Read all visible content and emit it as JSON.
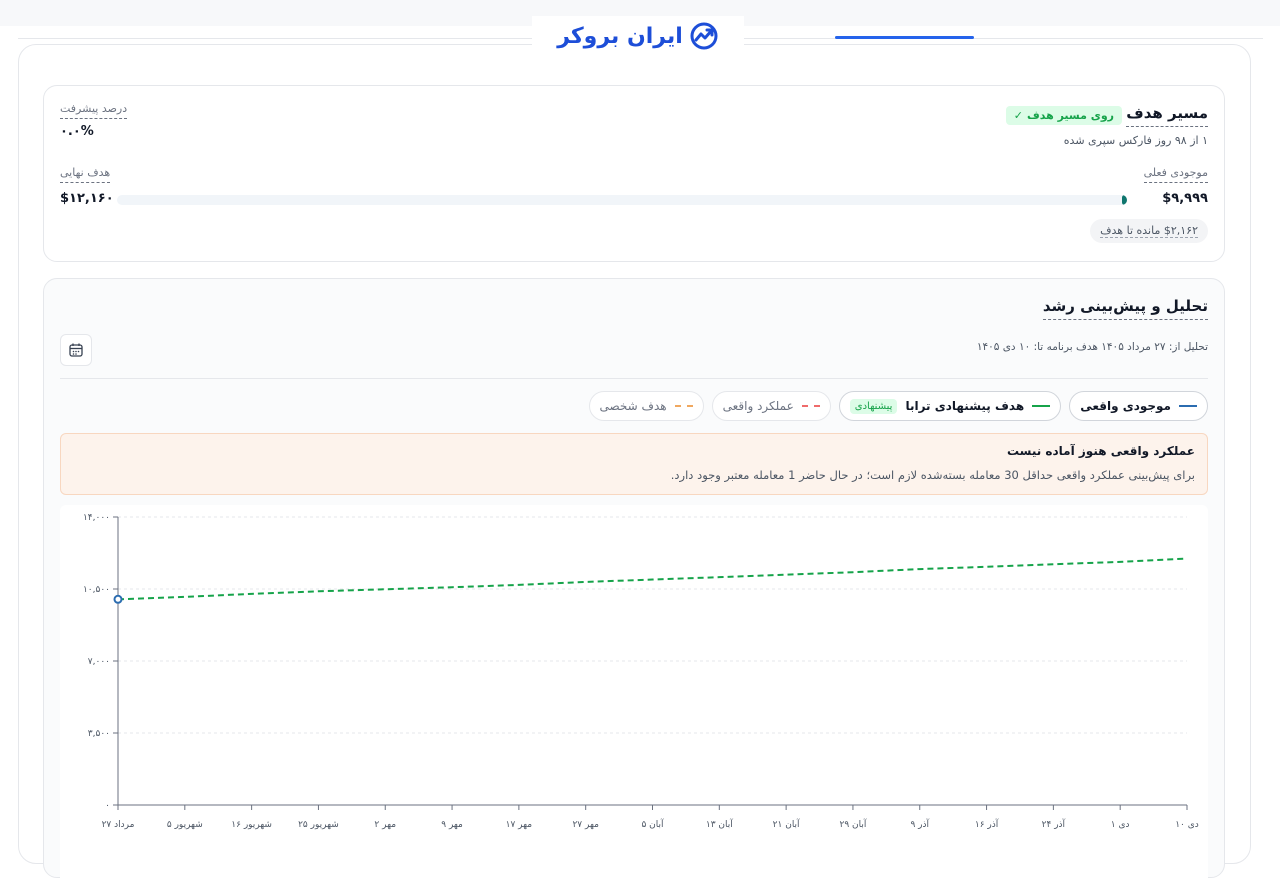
{
  "header": {
    "logo_text": "ایران بروکر"
  },
  "goal": {
    "title": "مسیر هدف",
    "status_badge": "روی مسیر هدف",
    "subtitle": "۱ از ۹۸ روز فارکس سپری شده",
    "progress_label": "درصد پیشرفت",
    "progress_value": "۰.۰%",
    "current_label": "موجودی فعلی",
    "current_value": "$۹,۹۹۹",
    "final_label": "هدف نهایی",
    "final_value": "$۱۲,۱۶۰",
    "remaining": "$۲,۱۶۲ مانده تا هدف",
    "progress_fraction": 0.005
  },
  "analysis": {
    "title": "تحلیل و پیش‌بینی رشد",
    "subtitle": "تحلیل از: ۲۷ مرداد ۱۴۰۵  هدف برنامه تا: ۱۰ دی ۱۴۰۵",
    "legend": [
      {
        "label": "موجودی واقعی",
        "color": "#2b6cb0",
        "style": "solid",
        "active": true
      },
      {
        "label": "هدف پیشنهادی ترابا",
        "color": "#16a34a",
        "style": "solid",
        "active": true,
        "tag": "پیشنهادی"
      },
      {
        "label": "عملکرد واقعی",
        "color": "#ef6b6b",
        "style": "dashed",
        "active": false
      },
      {
        "label": "هدف شخصی",
        "color": "#f0a860",
        "style": "dashed",
        "active": false
      }
    ],
    "alert_title": "عملکرد واقعی هنوز آماده نیست",
    "alert_body": "برای پیش‌بینی عملکرد واقعی حداقل 30 معامله بسته‌شده لازم است؛ در حال حاضر 1 معامله معتبر وجود دارد."
  },
  "colors": {
    "brand": "#1d4ed8",
    "target_line": "#16a34a",
    "actual_line": "#2b6cb0"
  },
  "chart_data": {
    "type": "line",
    "x": [
      "۲۷ مرداد",
      "۵ شهریور",
      "۱۶ شهریور",
      "۲۵ شهریور",
      "۲ مهر",
      "۹ مهر",
      "۱۷ مهر",
      "۲۷ مهر",
      "۵ آبان",
      "۱۳ آبان",
      "۲۱ آبان",
      "۲۹ آبان",
      "۹ آذر",
      "۱۶ آذر",
      "۲۴ آذر",
      "۱ دی",
      "۱۰ دی"
    ],
    "yticks": [
      "۰",
      "۳,۵۰۰",
      "۷,۰۰۰",
      "۱۰,۵۰۰",
      "۱۴,۰۰۰"
    ],
    "ylim": [
      0,
      14000
    ],
    "series": [
      {
        "name": "هدف پیشنهادی ترابا",
        "style": "dashed",
        "color": "#16a34a",
        "values": [
          9999,
          10116,
          10264,
          10389,
          10487,
          10586,
          10700,
          10844,
          10959,
          11076,
          11195,
          11316,
          11469,
          11578,
          11705,
          11818,
          11980
        ]
      },
      {
        "name": "موجودی واقعی",
        "style": "solid",
        "color": "#2b6cb0",
        "values": [
          9999
        ]
      }
    ]
  }
}
